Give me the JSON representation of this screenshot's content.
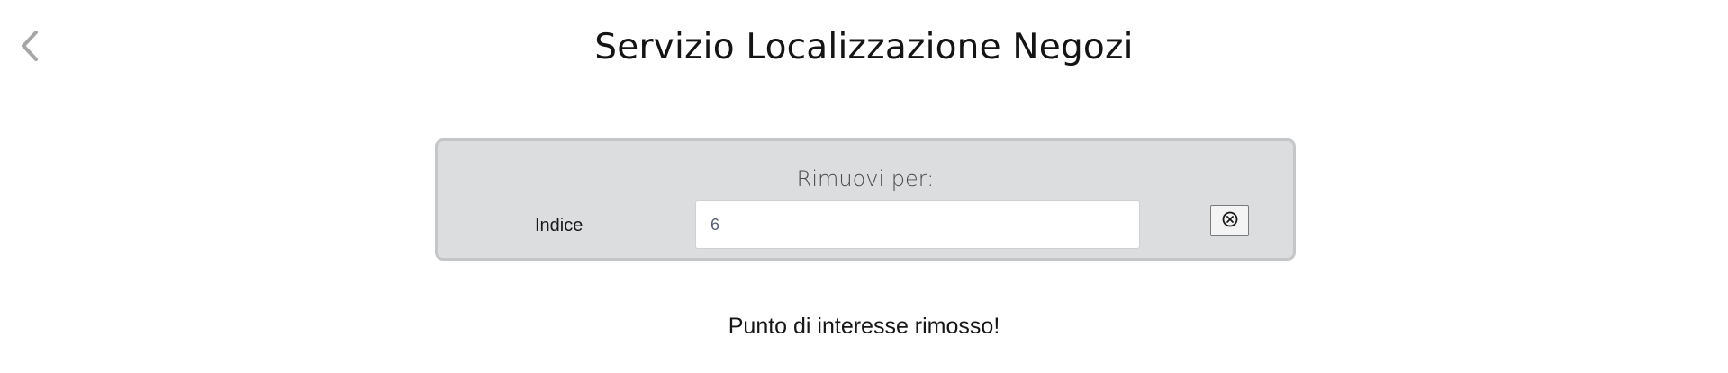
{
  "header": {
    "title": "Servizio Localizzazione Negozi",
    "back_icon": "chevron-left-icon"
  },
  "remove_panel": {
    "heading": "Rimuovi per:",
    "field_label": "Indice",
    "field_value": "6",
    "remove_icon": "close-circle-icon"
  },
  "status": {
    "message": "Punto di interesse rimosso!"
  },
  "colors": {
    "panel_background": "#dcdddf",
    "panel_border": "#c5c6c8",
    "back_icon": "#a6a6a6"
  }
}
